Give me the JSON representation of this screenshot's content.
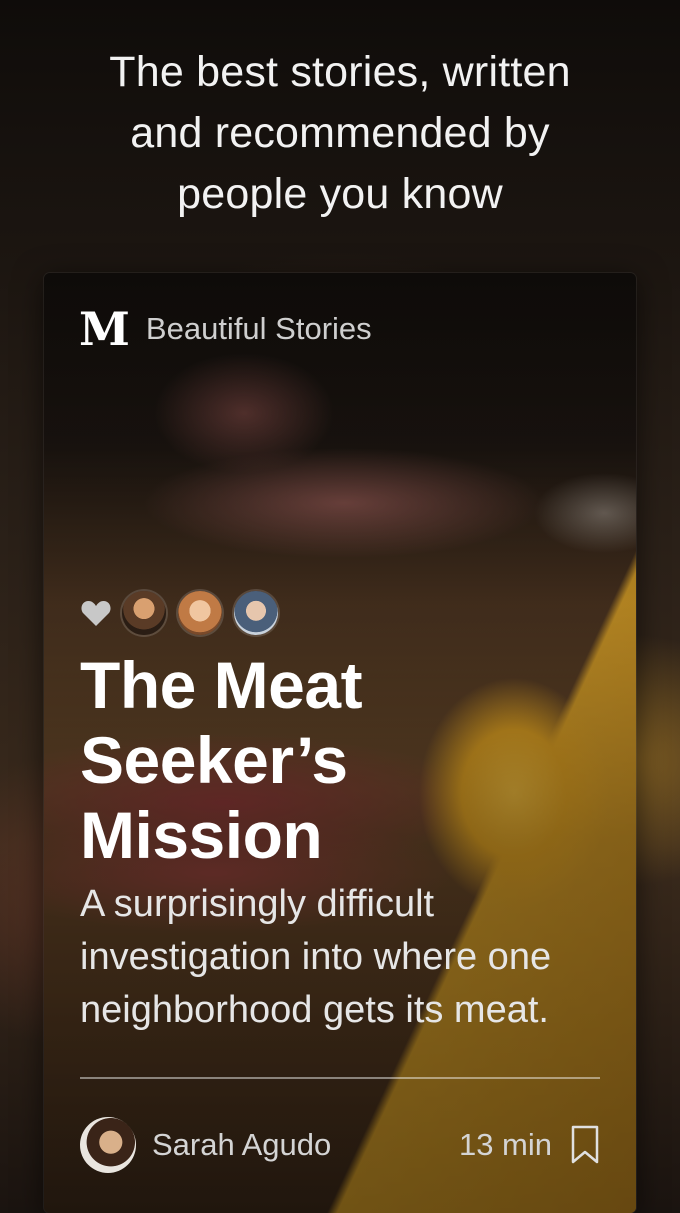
{
  "tagline": {
    "line1": "The best stories, written",
    "line2": "and recommended by",
    "line3": "people you know"
  },
  "card": {
    "publication": {
      "logo": "M",
      "name": "Beautiful Stories"
    },
    "recommenders": {
      "icon": "heart-icon",
      "avatars": [
        "avatar-1",
        "avatar-2",
        "avatar-3"
      ]
    },
    "title": {
      "line1": "The Meat",
      "line2": "Seeker’s",
      "line3": "Mission"
    },
    "subtitle": {
      "line1": "A surprisingly difficult",
      "line2": "investigation into where one",
      "line3": "neighborhood gets its meat."
    },
    "author": {
      "name": "Sarah Agudo"
    },
    "read_time": "13 min",
    "bookmark_icon": "bookmark-icon"
  },
  "colors": {
    "text_primary": "#ffffff",
    "text_secondary": "#d4d4d4",
    "heart": "#c8c8c8"
  }
}
